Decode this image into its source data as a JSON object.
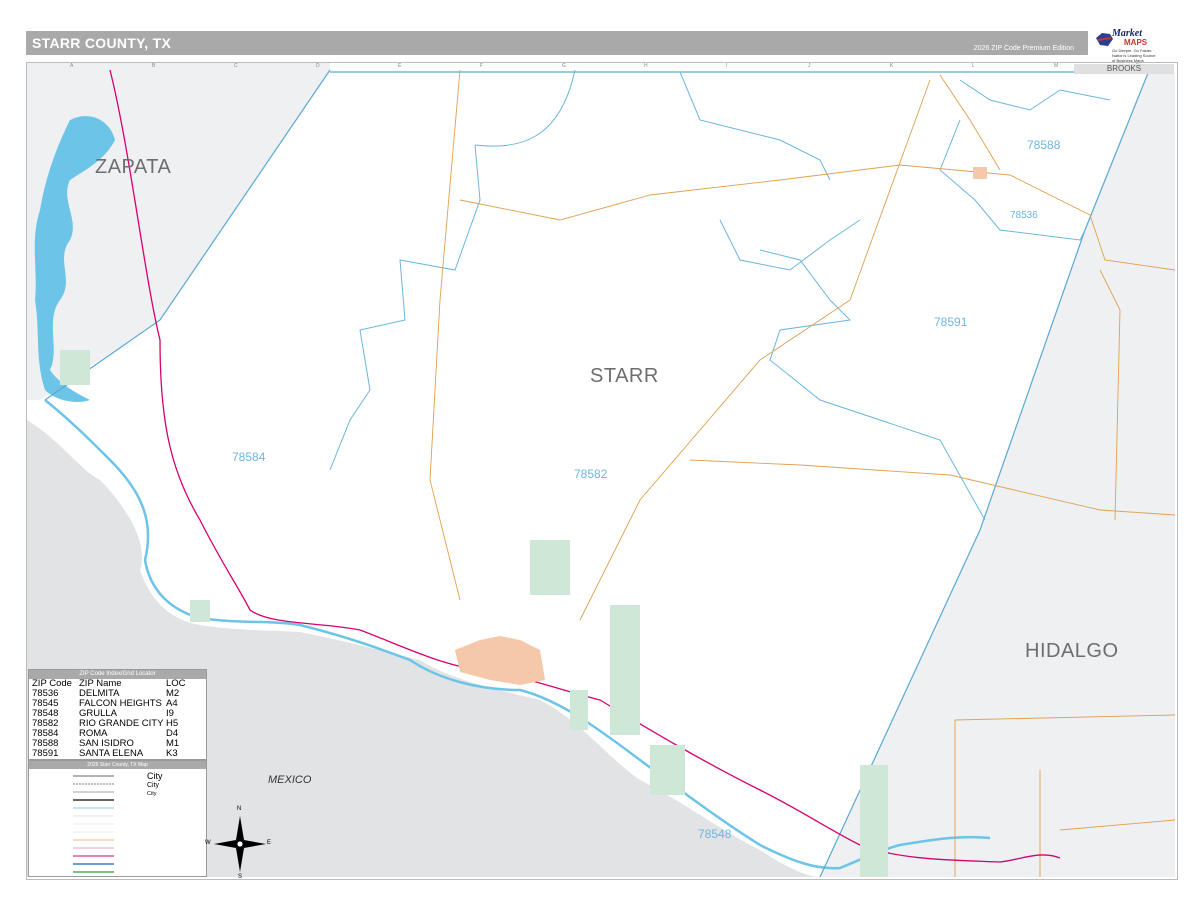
{
  "header": {
    "title": "STARR COUNTY, TX",
    "edition": "2026 ZIP Code Premium Edition"
  },
  "logo": {
    "name": "Market",
    "name2": "MAPS",
    "tagline": "Go Deeper. Go Faster. Nation's Leading Source of Business Maps"
  },
  "grid": {
    "columns": [
      "A",
      "B",
      "C",
      "D",
      "E",
      "F",
      "G",
      "H",
      "I",
      "J",
      "K",
      "L",
      "M",
      "N"
    ]
  },
  "map": {
    "counties": {
      "zapata": "ZAPATA",
      "starr": "STARR",
      "hidalgo": "HIDALGO",
      "brooks": "BROOKS"
    },
    "country": "MEXICO",
    "zips": {
      "z78588": "78588",
      "z78536": "78536",
      "z78591": "78591",
      "z78584": "78584",
      "z78582": "78582",
      "z78548": "78548"
    }
  },
  "zip_index": {
    "title": "ZIP Code Index/Grid Locator",
    "headers": {
      "code": "ZIP Code",
      "name": "ZIP Name",
      "loc": "LOC"
    },
    "rows": [
      {
        "code": "78536",
        "name": "DELMITA",
        "loc": "M2"
      },
      {
        "code": "78545",
        "name": "FALCON HEIGHTS",
        "loc": "A4"
      },
      {
        "code": "78548",
        "name": "GRULLA",
        "loc": "I9"
      },
      {
        "code": "78582",
        "name": "RIO GRANDE CITY",
        "loc": "H5"
      },
      {
        "code": "78584",
        "name": "ROMA",
        "loc": "D4"
      },
      {
        "code": "78588",
        "name": "SAN ISIDRO",
        "loc": "M1"
      },
      {
        "code": "78591",
        "name": "SANTA ELENA",
        "loc": "K3"
      }
    ]
  },
  "legend": {
    "title": "2026 Starr County, TX Map",
    "city_samples": [
      "City",
      "City",
      "City"
    ]
  },
  "compass": {
    "n": "N",
    "s": "S",
    "e": "E",
    "w": "W"
  },
  "colors": {
    "water": "#6cc4e8",
    "mexico": "#e1e3e5",
    "outside": "#eef0f2",
    "zip_boundary": "#6bb6dc",
    "highway": "#d6006e",
    "county_road": "#e0a050",
    "park": "#cfe7d6",
    "city": "#f4c8a8"
  }
}
